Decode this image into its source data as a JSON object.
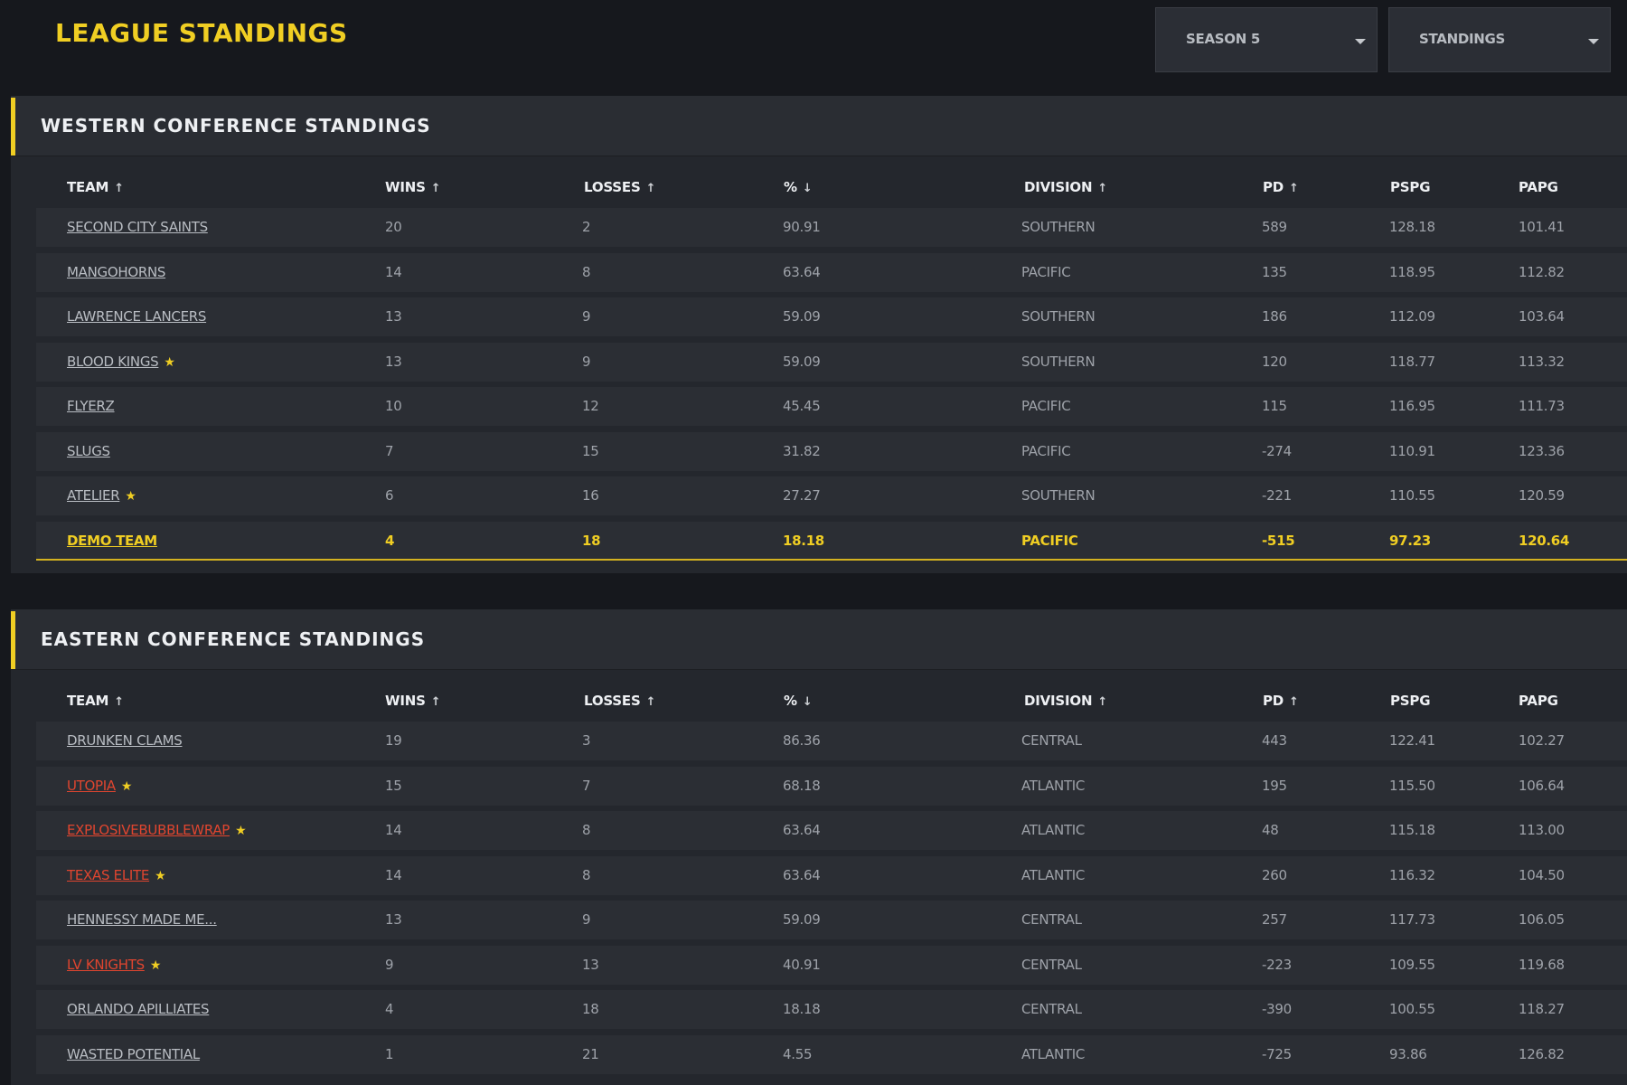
{
  "header": {
    "title": "LEAGUE STANDINGS",
    "season_select": "SEASON 5",
    "view_select": "STANDINGS"
  },
  "columns": {
    "team": "TEAM",
    "wins": "WINS",
    "losses": "LOSSES",
    "pct": "%",
    "division": "DIVISION",
    "pd": "PD",
    "pspg": "PSPG",
    "papg": "PAPG",
    "asc_arrow": "↑",
    "desc_arrow": "↓"
  },
  "colors": {
    "accent": "#f0ce23",
    "highlight_team_text": "#f0ce23",
    "flagged_team_text": "#e0452f",
    "background": "#16181d",
    "panel": "#24272d"
  },
  "western": {
    "title": "WESTERN CONFERENCE STANDINGS",
    "rows": [
      {
        "team": "SECOND CITY SAINTS",
        "star": false,
        "red": false,
        "wins": "20",
        "losses": "2",
        "pct": "90.91",
        "division": "SOUTHERN",
        "pd": "589",
        "pspg": "128.18",
        "papg": "101.41"
      },
      {
        "team": "MANGOHORNS",
        "star": false,
        "red": false,
        "wins": "14",
        "losses": "8",
        "pct": "63.64",
        "division": "PACIFIC",
        "pd": "135",
        "pspg": "118.95",
        "papg": "112.82"
      },
      {
        "team": "LAWRENCE LANCERS",
        "star": false,
        "red": false,
        "wins": "13",
        "losses": "9",
        "pct": "59.09",
        "division": "SOUTHERN",
        "pd": "186",
        "pspg": "112.09",
        "papg": "103.64"
      },
      {
        "team": "BLOOD KINGS",
        "star": true,
        "red": false,
        "wins": "13",
        "losses": "9",
        "pct": "59.09",
        "division": "SOUTHERN",
        "pd": "120",
        "pspg": "118.77",
        "papg": "113.32"
      },
      {
        "team": "FLYERZ",
        "star": false,
        "red": false,
        "wins": "10",
        "losses": "12",
        "pct": "45.45",
        "division": "PACIFIC",
        "pd": "115",
        "pspg": "116.95",
        "papg": "111.73"
      },
      {
        "team": "SLUGS",
        "star": false,
        "red": false,
        "wins": "7",
        "losses": "15",
        "pct": "31.82",
        "division": "PACIFIC",
        "pd": "-274",
        "pspg": "110.91",
        "papg": "123.36"
      },
      {
        "team": "ATELIER",
        "star": true,
        "red": false,
        "wins": "6",
        "losses": "16",
        "pct": "27.27",
        "division": "SOUTHERN",
        "pd": "-221",
        "pspg": "110.55",
        "papg": "120.59"
      },
      {
        "team": "DEMO TEAM",
        "star": false,
        "red": false,
        "highlight": true,
        "wins": "4",
        "losses": "18",
        "pct": "18.18",
        "division": "PACIFIC",
        "pd": "-515",
        "pspg": "97.23",
        "papg": "120.64"
      }
    ]
  },
  "eastern": {
    "title": "EASTERN CONFERENCE STANDINGS",
    "rows": [
      {
        "team": "DRUNKEN CLAMS",
        "star": false,
        "red": false,
        "wins": "19",
        "losses": "3",
        "pct": "86.36",
        "division": "CENTRAL",
        "pd": "443",
        "pspg": "122.41",
        "papg": "102.27"
      },
      {
        "team": "UTOPIA",
        "star": true,
        "red": true,
        "wins": "15",
        "losses": "7",
        "pct": "68.18",
        "division": "ATLANTIC",
        "pd": "195",
        "pspg": "115.50",
        "papg": "106.64"
      },
      {
        "team": "EXPLOSIVEBUBBLEWRAP",
        "star": true,
        "red": true,
        "wins": "14",
        "losses": "8",
        "pct": "63.64",
        "division": "ATLANTIC",
        "pd": "48",
        "pspg": "115.18",
        "papg": "113.00"
      },
      {
        "team": "TEXAS ELITE",
        "star": true,
        "red": true,
        "wins": "14",
        "losses": "8",
        "pct": "63.64",
        "division": "ATLANTIC",
        "pd": "260",
        "pspg": "116.32",
        "papg": "104.50"
      },
      {
        "team": "HENNESSY MADE ME...",
        "star": false,
        "red": false,
        "wins": "13",
        "losses": "9",
        "pct": "59.09",
        "division": "CENTRAL",
        "pd": "257",
        "pspg": "117.73",
        "papg": "106.05"
      },
      {
        "team": "LV KNIGHTS",
        "star": true,
        "red": true,
        "wins": "9",
        "losses": "13",
        "pct": "40.91",
        "division": "CENTRAL",
        "pd": "-223",
        "pspg": "109.55",
        "papg": "119.68"
      },
      {
        "team": "ORLANDO APILLIATES",
        "star": false,
        "red": false,
        "wins": "4",
        "losses": "18",
        "pct": "18.18",
        "division": "CENTRAL",
        "pd": "-390",
        "pspg": "100.55",
        "papg": "118.27"
      },
      {
        "team": "WASTED POTENTIAL",
        "star": false,
        "red": false,
        "wins": "1",
        "losses": "21",
        "pct": "4.55",
        "division": "ATLANTIC",
        "pd": "-725",
        "pspg": "93.86",
        "papg": "126.82"
      }
    ]
  }
}
